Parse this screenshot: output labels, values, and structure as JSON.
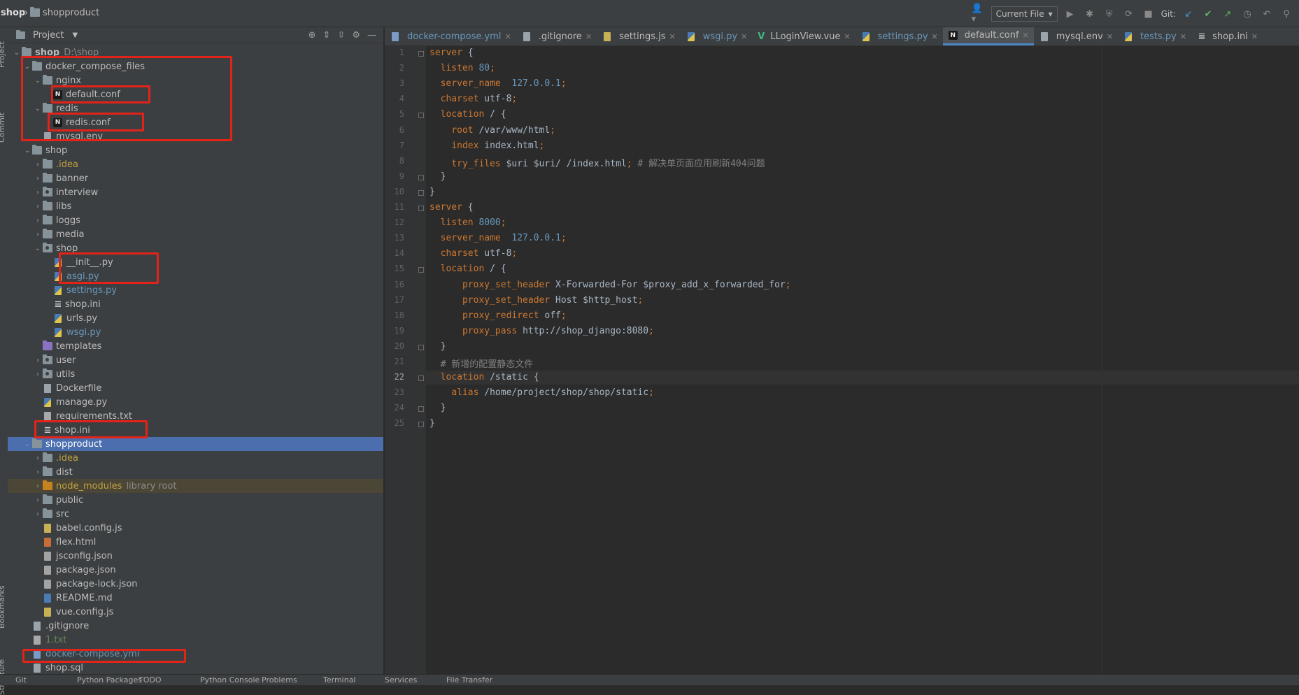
{
  "navbar": {
    "breadcrumb": [
      "shop",
      "shopproduct"
    ],
    "run_config": "Current File",
    "git_label": "Git:"
  },
  "side_strip": [
    "Project",
    "Commit",
    "Bookmarks",
    "Structure"
  ],
  "project_panel": {
    "title": "Project",
    "tree": [
      {
        "label": "shop",
        "path": "D:\\shop",
        "indent": 0,
        "arrow": "down",
        "icon": "folder",
        "bold": true
      },
      {
        "label": "docker_compose_files",
        "indent": 1,
        "arrow": "down",
        "icon": "folder"
      },
      {
        "label": "nginx",
        "indent": 2,
        "arrow": "down",
        "icon": "folder"
      },
      {
        "label": "default.conf",
        "indent": 3,
        "arrow": "",
        "icon": "nginx"
      },
      {
        "label": "redis",
        "indent": 2,
        "arrow": "down",
        "icon": "folder"
      },
      {
        "label": "redis.conf",
        "indent": 3,
        "arrow": "",
        "icon": "nginx"
      },
      {
        "label": "mysql.env",
        "indent": 2,
        "arrow": "",
        "icon": "file"
      },
      {
        "label": "shop",
        "indent": 1,
        "arrow": "down",
        "icon": "folder"
      },
      {
        "label": ".idea",
        "indent": 2,
        "arrow": "right",
        "icon": "folder",
        "color": "#c0a040"
      },
      {
        "label": "banner",
        "indent": 2,
        "arrow": "right",
        "icon": "folder"
      },
      {
        "label": "interview",
        "indent": 2,
        "arrow": "right",
        "icon": "folder-pkg"
      },
      {
        "label": "libs",
        "indent": 2,
        "arrow": "right",
        "icon": "folder"
      },
      {
        "label": "loggs",
        "indent": 2,
        "arrow": "right",
        "icon": "folder"
      },
      {
        "label": "media",
        "indent": 2,
        "arrow": "right",
        "icon": "folder"
      },
      {
        "label": "shop",
        "indent": 2,
        "arrow": "down",
        "icon": "folder-pkg"
      },
      {
        "label": "__init__.py",
        "indent": 3,
        "arrow": "",
        "icon": "py"
      },
      {
        "label": "asgi.py",
        "indent": 3,
        "arrow": "",
        "icon": "py",
        "color": "#6897bb"
      },
      {
        "label": "settings.py",
        "indent": 3,
        "arrow": "",
        "icon": "py",
        "color": "#6897bb"
      },
      {
        "label": "shop.ini",
        "indent": 3,
        "arrow": "",
        "icon": "ini"
      },
      {
        "label": "urls.py",
        "indent": 3,
        "arrow": "",
        "icon": "py"
      },
      {
        "label": "wsgi.py",
        "indent": 3,
        "arrow": "",
        "icon": "py",
        "color": "#6897bb"
      },
      {
        "label": "templates",
        "indent": 2,
        "arrow": "",
        "icon": "folder-purple"
      },
      {
        "label": "user",
        "indent": 2,
        "arrow": "right",
        "icon": "folder-pkg"
      },
      {
        "label": "utils",
        "indent": 2,
        "arrow": "right",
        "icon": "folder-pkg"
      },
      {
        "label": "Dockerfile",
        "indent": 2,
        "arrow": "",
        "icon": "file"
      },
      {
        "label": "manage.py",
        "indent": 2,
        "arrow": "",
        "icon": "py"
      },
      {
        "label": "requirements.txt",
        "indent": 2,
        "arrow": "",
        "icon": "txt"
      },
      {
        "label": "shop.ini",
        "indent": 2,
        "arrow": "",
        "icon": "ini"
      },
      {
        "label": "shopproduct",
        "indent": 1,
        "arrow": "down",
        "icon": "folder",
        "selected": true
      },
      {
        "label": ".idea",
        "indent": 2,
        "arrow": "right",
        "icon": "folder",
        "color": "#c0a040"
      },
      {
        "label": "dist",
        "indent": 2,
        "arrow": "right",
        "icon": "folder"
      },
      {
        "label": "node_modules",
        "extra": "library root",
        "indent": 2,
        "arrow": "right",
        "icon": "folder-orange",
        "color": "#c0a040",
        "excluded": true
      },
      {
        "label": "public",
        "indent": 2,
        "arrow": "right",
        "icon": "folder"
      },
      {
        "label": "src",
        "indent": 2,
        "arrow": "right",
        "icon": "folder"
      },
      {
        "label": "babel.config.js",
        "indent": 2,
        "arrow": "",
        "icon": "js"
      },
      {
        "label": "flex.html",
        "indent": 2,
        "arrow": "",
        "icon": "html"
      },
      {
        "label": "jsconfig.json",
        "indent": 2,
        "arrow": "",
        "icon": "json"
      },
      {
        "label": "package.json",
        "indent": 2,
        "arrow": "",
        "icon": "json"
      },
      {
        "label": "package-lock.json",
        "indent": 2,
        "arrow": "",
        "icon": "json"
      },
      {
        "label": "README.md",
        "indent": 2,
        "arrow": "",
        "icon": "md"
      },
      {
        "label": "vue.config.js",
        "indent": 2,
        "arrow": "",
        "icon": "js"
      },
      {
        "label": ".gitignore",
        "indent": 1,
        "arrow": "",
        "icon": "file"
      },
      {
        "label": "1.txt",
        "indent": 1,
        "arrow": "",
        "icon": "txt",
        "color": "#6a8759"
      },
      {
        "label": "docker-compose.yml",
        "indent": 1,
        "arrow": "",
        "icon": "yml",
        "color": "#6897bb"
      },
      {
        "label": "shop.sql",
        "indent": 1,
        "arrow": "",
        "icon": "file"
      }
    ]
  },
  "editor": {
    "tabs": [
      {
        "label": "docker-compose.yml",
        "icon": "yml",
        "color": "#6897bb"
      },
      {
        "label": ".gitignore",
        "icon": "file"
      },
      {
        "label": "settings.js",
        "icon": "js"
      },
      {
        "label": "wsgi.py",
        "icon": "py",
        "color": "#6897bb"
      },
      {
        "label": "LLoginView.vue",
        "icon": "vue"
      },
      {
        "label": "settings.py",
        "icon": "py",
        "color": "#6897bb"
      },
      {
        "label": "default.conf",
        "icon": "nginx",
        "active": true
      },
      {
        "label": "mysql.env",
        "icon": "file"
      },
      {
        "label": "tests.py",
        "icon": "py",
        "color": "#6897bb"
      },
      {
        "label": "shop.ini",
        "icon": "ini"
      }
    ],
    "current_line": 22,
    "lines": [
      [
        [
          "kw",
          "server"
        ],
        [
          "t",
          " {"
        ]
      ],
      [
        [
          "t",
          "  "
        ],
        [
          "kw",
          "listen"
        ],
        [
          "t",
          " "
        ],
        [
          "num",
          "80"
        ],
        [
          "kw",
          ";"
        ]
      ],
      [
        [
          "t",
          "  "
        ],
        [
          "kw",
          "server_name"
        ],
        [
          "t",
          "  "
        ],
        [
          "num",
          "127.0.0.1"
        ],
        [
          "kw",
          ";"
        ]
      ],
      [
        [
          "t",
          "  "
        ],
        [
          "kw",
          "charset"
        ],
        [
          "t",
          " utf-8"
        ],
        [
          "kw",
          ";"
        ]
      ],
      [
        [
          "t",
          "  "
        ],
        [
          "kw",
          "location"
        ],
        [
          "t",
          " / {"
        ]
      ],
      [
        [
          "t",
          "    "
        ],
        [
          "kw",
          "root"
        ],
        [
          "t",
          " /var/www/html"
        ],
        [
          "kw",
          ";"
        ]
      ],
      [
        [
          "t",
          "    "
        ],
        [
          "kw",
          "index"
        ],
        [
          "t",
          " index.html"
        ],
        [
          "kw",
          ";"
        ]
      ],
      [
        [
          "t",
          "    "
        ],
        [
          "kw",
          "try_files"
        ],
        [
          "t",
          " $uri $uri/ /index.html"
        ],
        [
          "kw",
          ";"
        ],
        [
          "cm",
          " # 解决单页面应用刷新404问题"
        ]
      ],
      [
        [
          "t",
          "  }"
        ]
      ],
      [
        [
          "t",
          "}"
        ]
      ],
      [
        [
          "kw",
          "server"
        ],
        [
          "t",
          " {"
        ]
      ],
      [
        [
          "t",
          "  "
        ],
        [
          "kw",
          "listen"
        ],
        [
          "t",
          " "
        ],
        [
          "num",
          "8000"
        ],
        [
          "kw",
          ";"
        ]
      ],
      [
        [
          "t",
          "  "
        ],
        [
          "kw",
          "server_name"
        ],
        [
          "t",
          "  "
        ],
        [
          "num",
          "127.0.0.1"
        ],
        [
          "kw",
          ";"
        ]
      ],
      [
        [
          "t",
          "  "
        ],
        [
          "kw",
          "charset"
        ],
        [
          "t",
          " utf-8"
        ],
        [
          "kw",
          ";"
        ]
      ],
      [
        [
          "t",
          "  "
        ],
        [
          "kw",
          "location"
        ],
        [
          "t",
          " / {"
        ]
      ],
      [
        [
          "t",
          "      "
        ],
        [
          "kw",
          "proxy_set_header"
        ],
        [
          "t",
          " X-Forwarded-For $proxy_add_x_forwarded_for"
        ],
        [
          "kw",
          ";"
        ]
      ],
      [
        [
          "t",
          "      "
        ],
        [
          "kw",
          "proxy_set_header"
        ],
        [
          "t",
          " Host $http_host"
        ],
        [
          "kw",
          ";"
        ]
      ],
      [
        [
          "t",
          "      "
        ],
        [
          "kw",
          "proxy_redirect"
        ],
        [
          "t",
          " off"
        ],
        [
          "kw",
          ";"
        ]
      ],
      [
        [
          "t",
          "      "
        ],
        [
          "kw",
          "proxy_pass"
        ],
        [
          "t",
          " http://shop_django:8080"
        ],
        [
          "kw",
          ";"
        ]
      ],
      [
        [
          "t",
          "  }"
        ]
      ],
      [
        [
          "t",
          "  "
        ],
        [
          "cm",
          "# 新增的配置静态文件"
        ]
      ],
      [
        [
          "t",
          "  "
        ],
        [
          "kw",
          "location"
        ],
        [
          "t",
          " /static {"
        ]
      ],
      [
        [
          "t",
          "    "
        ],
        [
          "kw",
          "alias"
        ],
        [
          "t",
          " /home/project/shop/shop/static"
        ],
        [
          "kw",
          ";"
        ]
      ],
      [
        [
          "t",
          "  }"
        ]
      ],
      [
        [
          "t",
          "}"
        ]
      ]
    ]
  },
  "statusbar": [
    "Git",
    "Python Packages",
    "TODO",
    "Python Console",
    "Problems",
    "Terminal",
    "Services",
    "File Transfer"
  ]
}
